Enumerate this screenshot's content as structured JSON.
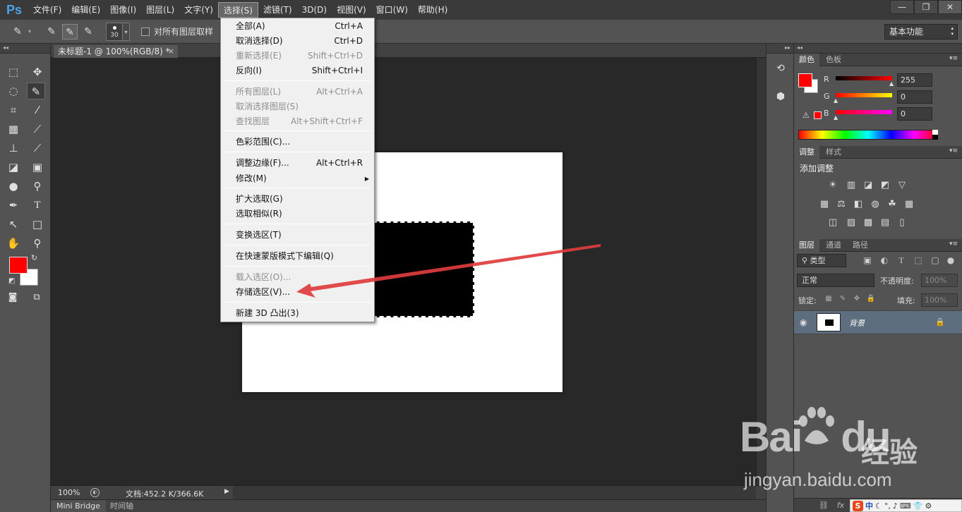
{
  "app": {
    "logo": "Ps",
    "menus": [
      "文件(F)",
      "编辑(E)",
      "图像(I)",
      "图层(L)",
      "文字(Y)",
      "选择(S)",
      "滤镜(T)",
      "3D(D)",
      "视图(V)",
      "窗口(W)",
      "帮助(H)"
    ],
    "active_menu": "选择(S)",
    "window_controls": [
      "—",
      "❐",
      "✕"
    ]
  },
  "options_bar": {
    "brush_size": "30",
    "sample_all_layers_label": "对所有图层取样",
    "workspace": "基本功能"
  },
  "document": {
    "tab_title": "未标题-1 @ 100%(RGB/8) *",
    "tab_close": "×",
    "zoom": "100%",
    "doc_info": "文档:452.2 K/366.6K",
    "bottom_tabs": [
      "Mini Bridge",
      "时间轴"
    ]
  },
  "select_menu": {
    "items": [
      {
        "label": "全部(A)",
        "shortcut": "Ctrl+A",
        "disabled": false
      },
      {
        "label": "取消选择(D)",
        "shortcut": "Ctrl+D",
        "disabled": false
      },
      {
        "label": "重新选择(E)",
        "shortcut": "Shift+Ctrl+D",
        "disabled": true
      },
      {
        "label": "反向(I)",
        "shortcut": "Shift+Ctrl+I",
        "disabled": false
      },
      {
        "label": "所有图层(L)",
        "shortcut": "Alt+Ctrl+A",
        "disabled": true
      },
      {
        "label": "取消选择图层(S)",
        "shortcut": "",
        "disabled": true
      },
      {
        "label": "查找图层",
        "shortcut": "Alt+Shift+Ctrl+F",
        "disabled": true
      },
      {
        "label": "色彩范围(C)...",
        "shortcut": "",
        "disabled": false
      },
      {
        "label": "调整边缘(F)...",
        "shortcut": "Alt+Ctrl+R",
        "disabled": false
      },
      {
        "label": "修改(M)",
        "shortcut": "",
        "disabled": false
      },
      {
        "label": "扩大选取(G)",
        "shortcut": "",
        "disabled": false
      },
      {
        "label": "选取相似(R)",
        "shortcut": "",
        "disabled": false
      },
      {
        "label": "变换选区(T)",
        "shortcut": "",
        "disabled": false
      },
      {
        "label": "在快速蒙版模式下编辑(Q)",
        "shortcut": "",
        "disabled": false
      },
      {
        "label": "载入选区(O)...",
        "shortcut": "",
        "disabled": true
      },
      {
        "label": "存储选区(V)...",
        "shortcut": "",
        "disabled": false
      },
      {
        "label": "新建 3D 凸出(3)",
        "shortcut": "",
        "disabled": false
      }
    ]
  },
  "color_panel": {
    "tabs": [
      "颜色",
      "色板"
    ],
    "channels": [
      {
        "label": "R",
        "value": "255"
      },
      {
        "label": "G",
        "value": "0"
      },
      {
        "label": "B",
        "value": "0"
      }
    ],
    "fg_color": "#ff0000",
    "bg_color": "#ffffff"
  },
  "adjust_panel": {
    "tabs": [
      "调整",
      "样式"
    ],
    "title": "添加调整"
  },
  "layers_panel": {
    "tabs": [
      "图层",
      "通道",
      "路径"
    ],
    "filter": "类型",
    "blend_mode": "正常",
    "opacity_label": "不透明度:",
    "opacity_value": "100%",
    "lock_label": "锁定:",
    "fill_label": "填充:",
    "fill_value": "100%",
    "layer_name": "背景"
  },
  "watermark": {
    "logo": "Bai",
    "logo_tail": "du",
    "cn": "经验",
    "url": "jingyan.baidu.com"
  },
  "ime": {
    "s": "S",
    "zh": "中"
  }
}
